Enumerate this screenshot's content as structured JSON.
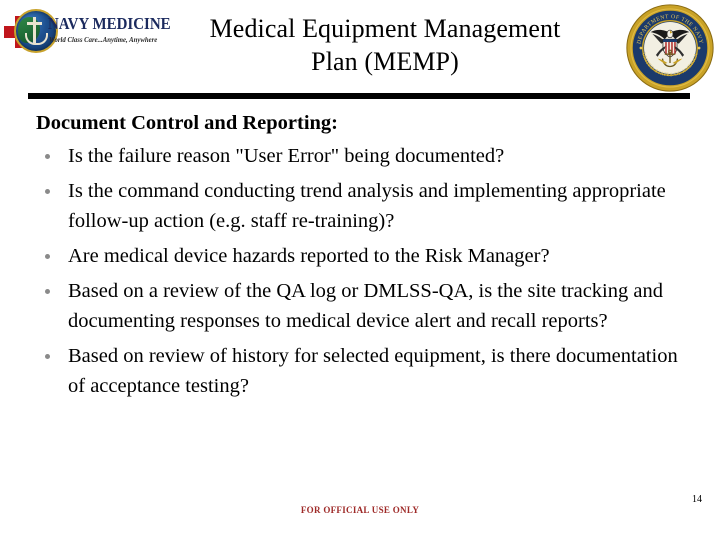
{
  "slide": {
    "title": "Medical Equipment Management\nPlan (MEMP)",
    "page_number": "14",
    "classification_footer": "FOR OFFICIAL USE ONLY",
    "footer_color": "#9e2a28"
  },
  "logo": {
    "wordmark": "NAVY MEDICINE",
    "tagline": "World Class Care...Anytime, Anywhere",
    "wordmark_color": "#1b2a5e",
    "cross_color": "#c0161c"
  },
  "seal": {
    "outer_text_top": "DEPARTMENT OF THE NAVY",
    "outer_text_bottom": "UNITED STATES OF AMERICA",
    "ring_color": "#1b3a6b",
    "rope_color": "#c9a227"
  },
  "content": {
    "heading": "Document Control and Reporting:",
    "bullets": [
      "Is the failure reason \"User Error\" being documented?",
      "Is the command conducting trend analysis and implementing appropriate follow-up action (e.g. staff re-training)?",
      "Are medical device hazards reported to the Risk Manager?",
      "Based on a review of the QA log or DMLSS-QA, is the site tracking and documenting responses to medical device alert and recall reports?",
      "Based on review of history for selected equipment, is there documentation of acceptance testing?"
    ]
  }
}
